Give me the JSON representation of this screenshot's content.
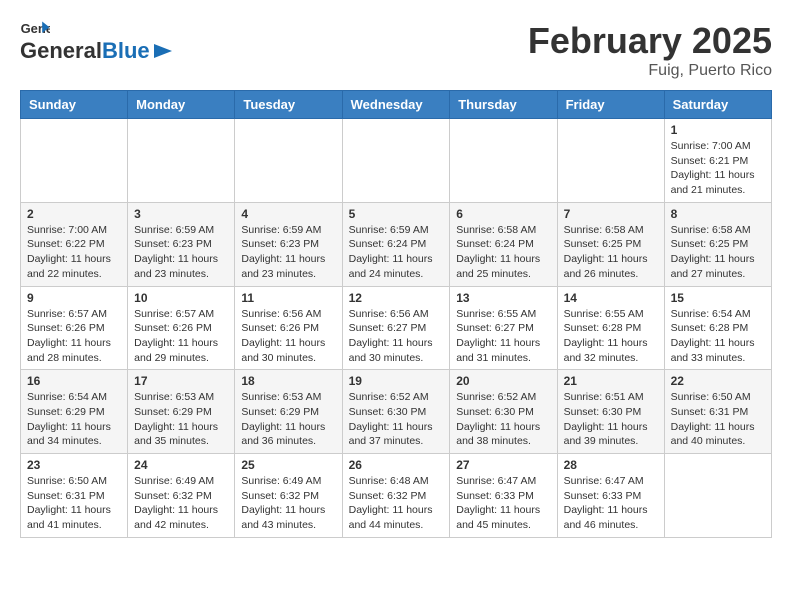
{
  "logo": {
    "text_general": "General",
    "text_blue": "Blue"
  },
  "calendar": {
    "title": "February 2025",
    "subtitle": "Fuig, Puerto Rico",
    "days_of_week": [
      "Sunday",
      "Monday",
      "Tuesday",
      "Wednesday",
      "Thursday",
      "Friday",
      "Saturday"
    ],
    "weeks": [
      [
        {
          "day": "",
          "info": ""
        },
        {
          "day": "",
          "info": ""
        },
        {
          "day": "",
          "info": ""
        },
        {
          "day": "",
          "info": ""
        },
        {
          "day": "",
          "info": ""
        },
        {
          "day": "",
          "info": ""
        },
        {
          "day": "1",
          "info": "Sunrise: 7:00 AM\nSunset: 6:21 PM\nDaylight: 11 hours\nand 21 minutes."
        }
      ],
      [
        {
          "day": "2",
          "info": "Sunrise: 7:00 AM\nSunset: 6:22 PM\nDaylight: 11 hours\nand 22 minutes."
        },
        {
          "day": "3",
          "info": "Sunrise: 6:59 AM\nSunset: 6:23 PM\nDaylight: 11 hours\nand 23 minutes."
        },
        {
          "day": "4",
          "info": "Sunrise: 6:59 AM\nSunset: 6:23 PM\nDaylight: 11 hours\nand 23 minutes."
        },
        {
          "day": "5",
          "info": "Sunrise: 6:59 AM\nSunset: 6:24 PM\nDaylight: 11 hours\nand 24 minutes."
        },
        {
          "day": "6",
          "info": "Sunrise: 6:58 AM\nSunset: 6:24 PM\nDaylight: 11 hours\nand 25 minutes."
        },
        {
          "day": "7",
          "info": "Sunrise: 6:58 AM\nSunset: 6:25 PM\nDaylight: 11 hours\nand 26 minutes."
        },
        {
          "day": "8",
          "info": "Sunrise: 6:58 AM\nSunset: 6:25 PM\nDaylight: 11 hours\nand 27 minutes."
        }
      ],
      [
        {
          "day": "9",
          "info": "Sunrise: 6:57 AM\nSunset: 6:26 PM\nDaylight: 11 hours\nand 28 minutes."
        },
        {
          "day": "10",
          "info": "Sunrise: 6:57 AM\nSunset: 6:26 PM\nDaylight: 11 hours\nand 29 minutes."
        },
        {
          "day": "11",
          "info": "Sunrise: 6:56 AM\nSunset: 6:26 PM\nDaylight: 11 hours\nand 30 minutes."
        },
        {
          "day": "12",
          "info": "Sunrise: 6:56 AM\nSunset: 6:27 PM\nDaylight: 11 hours\nand 30 minutes."
        },
        {
          "day": "13",
          "info": "Sunrise: 6:55 AM\nSunset: 6:27 PM\nDaylight: 11 hours\nand 31 minutes."
        },
        {
          "day": "14",
          "info": "Sunrise: 6:55 AM\nSunset: 6:28 PM\nDaylight: 11 hours\nand 32 minutes."
        },
        {
          "day": "15",
          "info": "Sunrise: 6:54 AM\nSunset: 6:28 PM\nDaylight: 11 hours\nand 33 minutes."
        }
      ],
      [
        {
          "day": "16",
          "info": "Sunrise: 6:54 AM\nSunset: 6:29 PM\nDaylight: 11 hours\nand 34 minutes."
        },
        {
          "day": "17",
          "info": "Sunrise: 6:53 AM\nSunset: 6:29 PM\nDaylight: 11 hours\nand 35 minutes."
        },
        {
          "day": "18",
          "info": "Sunrise: 6:53 AM\nSunset: 6:29 PM\nDaylight: 11 hours\nand 36 minutes."
        },
        {
          "day": "19",
          "info": "Sunrise: 6:52 AM\nSunset: 6:30 PM\nDaylight: 11 hours\nand 37 minutes."
        },
        {
          "day": "20",
          "info": "Sunrise: 6:52 AM\nSunset: 6:30 PM\nDaylight: 11 hours\nand 38 minutes."
        },
        {
          "day": "21",
          "info": "Sunrise: 6:51 AM\nSunset: 6:30 PM\nDaylight: 11 hours\nand 39 minutes."
        },
        {
          "day": "22",
          "info": "Sunrise: 6:50 AM\nSunset: 6:31 PM\nDaylight: 11 hours\nand 40 minutes."
        }
      ],
      [
        {
          "day": "23",
          "info": "Sunrise: 6:50 AM\nSunset: 6:31 PM\nDaylight: 11 hours\nand 41 minutes."
        },
        {
          "day": "24",
          "info": "Sunrise: 6:49 AM\nSunset: 6:32 PM\nDaylight: 11 hours\nand 42 minutes."
        },
        {
          "day": "25",
          "info": "Sunrise: 6:49 AM\nSunset: 6:32 PM\nDaylight: 11 hours\nand 43 minutes."
        },
        {
          "day": "26",
          "info": "Sunrise: 6:48 AM\nSunset: 6:32 PM\nDaylight: 11 hours\nand 44 minutes."
        },
        {
          "day": "27",
          "info": "Sunrise: 6:47 AM\nSunset: 6:33 PM\nDaylight: 11 hours\nand 45 minutes."
        },
        {
          "day": "28",
          "info": "Sunrise: 6:47 AM\nSunset: 6:33 PM\nDaylight: 11 hours\nand 46 minutes."
        },
        {
          "day": "",
          "info": ""
        }
      ]
    ]
  }
}
